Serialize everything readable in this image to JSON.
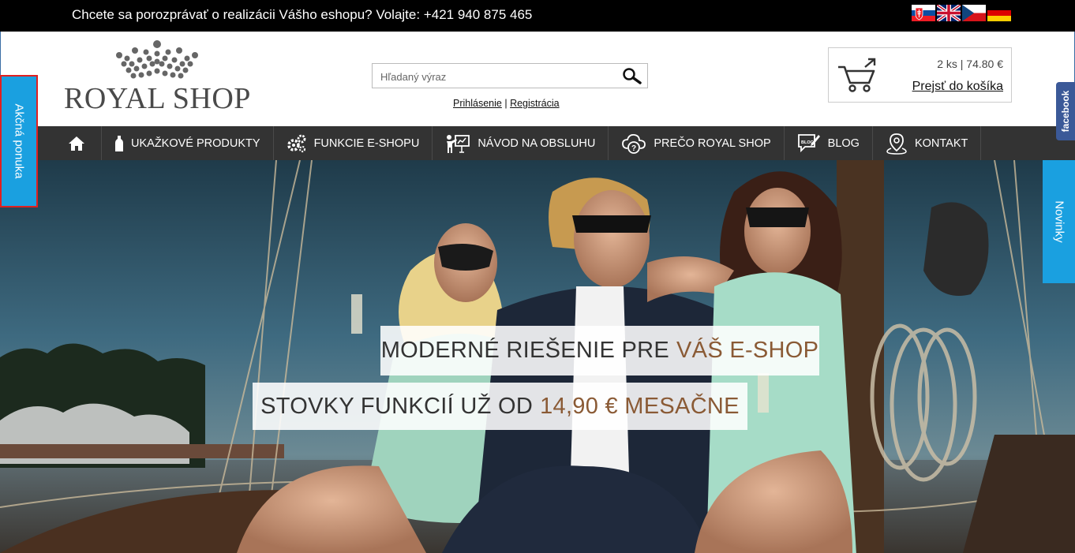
{
  "topbar": {
    "phone_text": "Chcete sa porozprávať o realizácii Vášho eshopu? Volajte: +421 940 875 465",
    "languages": [
      "sk-flag-icon",
      "uk-flag-icon",
      "cz-flag-icon",
      "de-flag-icon"
    ]
  },
  "logo": {
    "text": "ROYAL SHOP",
    "icon": "crown-icon"
  },
  "search": {
    "placeholder": "Hľadaný výraz",
    "value": "",
    "icon": "search-icon"
  },
  "auth": {
    "login": "Prihlásenie",
    "separator": "|",
    "register": "Registrácia"
  },
  "cart": {
    "count": "2 ks | 74.80 €",
    "go_label": "Prejsť do košíka",
    "icon": "cart-icon"
  },
  "nav": {
    "items": [
      {
        "label": "",
        "icon": "home-icon"
      },
      {
        "label": "UKAŽKOVÉ PRODUKTY",
        "icon": "bottle-icon"
      },
      {
        "label": "FUNKCIE E-SHOPU",
        "icon": "gears-icon"
      },
      {
        "label": "NÁVOD NA OBSLUHU",
        "icon": "presentation-icon"
      },
      {
        "label": "PREČO ROYAL SHOP",
        "icon": "cloud-question-icon"
      },
      {
        "label": "BLOG",
        "icon": "blog-icon"
      },
      {
        "label": "KONTAKT",
        "icon": "location-pin-icon"
      }
    ]
  },
  "hero": {
    "line1_main": "MODERNÉ RIEŠENIE PRE",
    "line1_accent": "VÁŠ E-SHOP",
    "line2_main": "STOVKY FUNKCIÍ UŽ OD",
    "line2_accent": "14,90 € MESAČNE"
  },
  "side_tabs": {
    "left": "Akčná ponuka",
    "facebook": "facebook",
    "right": "Novinky"
  },
  "colors": {
    "topbar_bg": "#000000",
    "nav_bg": "#333333",
    "tab_blue": "#1aa0e0",
    "facebook_blue": "#3b5998",
    "accent_brown": "#8a5a35",
    "highlight_red": "#e02020"
  }
}
